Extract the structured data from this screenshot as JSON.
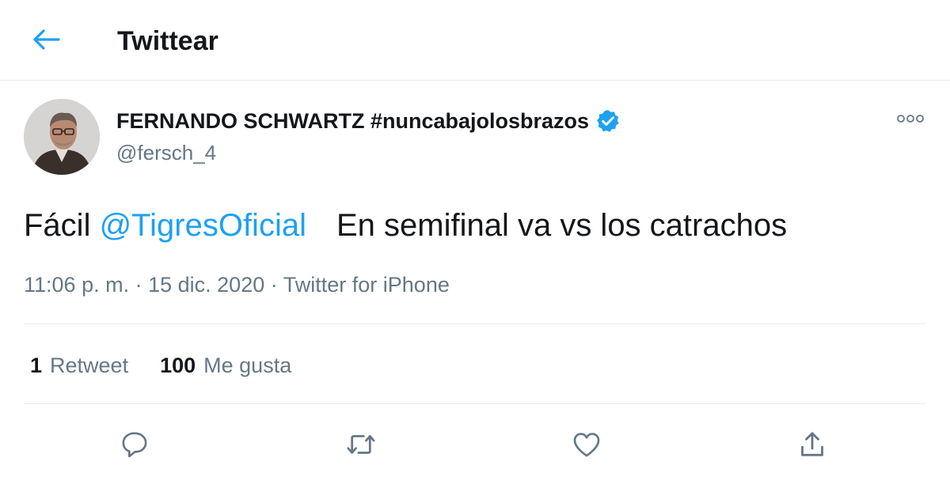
{
  "header": {
    "title": "Twittear",
    "back_icon": "back-arrow-icon"
  },
  "author": {
    "display_name": "FERNANDO SCHWARTZ #nuncabajolosbrazos",
    "handle": "@fersch_4",
    "verified_icon": "verified-badge-icon"
  },
  "tweet": {
    "text_prefix": "Fácil",
    "mention": "@TigresOficial",
    "text_suffix": "En semifinal va vs los catrachos"
  },
  "meta": {
    "time": "11:06 p. m.",
    "sep1": "·",
    "date": "15 dic. 2020",
    "sep2": "·",
    "source": "Twitter for iPhone"
  },
  "stats": {
    "retweets_count": "1",
    "retweets_label": "Retweet",
    "likes_count": "100",
    "likes_label": "Me gusta"
  },
  "actions": [
    "reply-icon",
    "retweet-icon",
    "like-icon",
    "share-icon"
  ],
  "colors": {
    "accent": "#1da1f2",
    "text": "#14171a",
    "secondary": "#657786",
    "divider": "#e6ecf0"
  }
}
